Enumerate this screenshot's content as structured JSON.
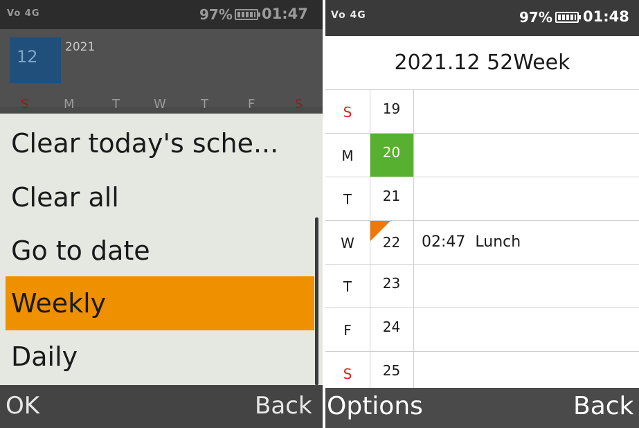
{
  "left_phone": {
    "status": {
      "network": "Vo 4G",
      "battery": "97%",
      "time": "01:47"
    },
    "calendar": {
      "month": "12",
      "year": "2021",
      "weekdays": [
        "S",
        "M",
        "T",
        "W",
        "T",
        "F",
        "S"
      ]
    },
    "menu": {
      "items": [
        "Clear today's sche...",
        "Clear all",
        "Go to date",
        "Weekly",
        "Daily"
      ],
      "selected": "Weekly"
    },
    "softkeys": {
      "left": "OK",
      "right": "Back"
    }
  },
  "right_phone": {
    "status": {
      "network": "Vo 4G",
      "battery": "97%",
      "time": "01:48"
    },
    "title": "2021.12 52Week",
    "days": [
      {
        "dow": "S",
        "date": "19",
        "event": ""
      },
      {
        "dow": "M",
        "date": "20",
        "event": ""
      },
      {
        "dow": "T",
        "date": "21",
        "event": ""
      },
      {
        "dow": "W",
        "date": "22",
        "event": "02:47  Lunch"
      },
      {
        "dow": "T",
        "date": "23",
        "event": ""
      },
      {
        "dow": "F",
        "date": "24",
        "event": ""
      },
      {
        "dow": "S",
        "date": "25",
        "event": ""
      }
    ],
    "today_date": "20",
    "softkeys": {
      "left": "Options",
      "right": "Back"
    }
  },
  "colors": {
    "menu_selected": "#ef9000",
    "today_highlight": "#58b030",
    "event_marker": "#f0780a",
    "weekend_text": "#e02020",
    "month_box": "#1f4f7a"
  }
}
